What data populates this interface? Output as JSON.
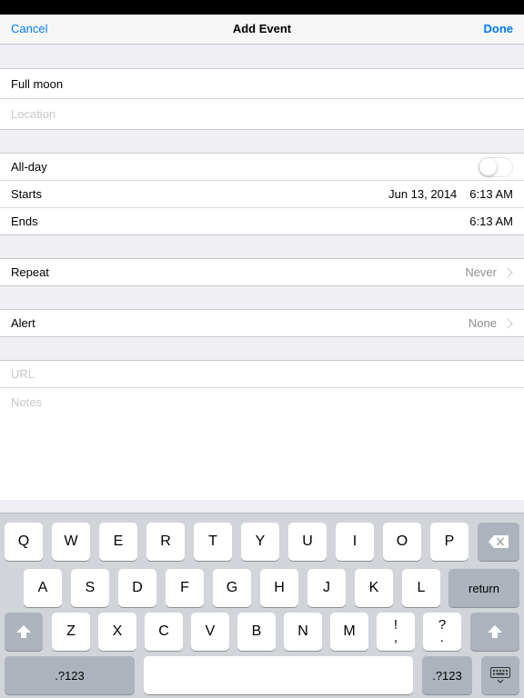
{
  "nav": {
    "cancel": "Cancel",
    "title": "Add Event",
    "done": "Done"
  },
  "form": {
    "title_value": "Full moon",
    "location_placeholder": "Location",
    "allday_label": "All-day",
    "allday_on": false,
    "starts_label": "Starts",
    "starts_date": "Jun 13, 2014",
    "starts_time": "6:13 AM",
    "ends_label": "Ends",
    "ends_time": "6:13 AM",
    "repeat_label": "Repeat",
    "repeat_value": "Never",
    "alert_label": "Alert",
    "alert_value": "None",
    "url_placeholder": "URL",
    "notes_placeholder": "Notes"
  },
  "keyboard": {
    "row1": [
      "Q",
      "W",
      "E",
      "R",
      "T",
      "Y",
      "U",
      "I",
      "O",
      "P"
    ],
    "row2": [
      "A",
      "S",
      "D",
      "F",
      "G",
      "H",
      "J",
      "K",
      "L"
    ],
    "row3": [
      "Z",
      "X",
      "C",
      "V",
      "B",
      "N",
      "M"
    ],
    "punct1_top": "!",
    "punct1_bottom": ",",
    "punct2_top": "?",
    "punct2_bottom": ".",
    "return": "return",
    "numbers_left": ".?123",
    "numbers_right": ".?123",
    "icons": {
      "delete": "backspace-icon",
      "shift": "shift-icon",
      "dismiss": "keyboard-dismiss-icon"
    }
  },
  "colors": {
    "accent": "#007aff",
    "placeholder": "#c7c7cd",
    "background": "#efeff4",
    "keyboard": "#d1d4d9"
  }
}
